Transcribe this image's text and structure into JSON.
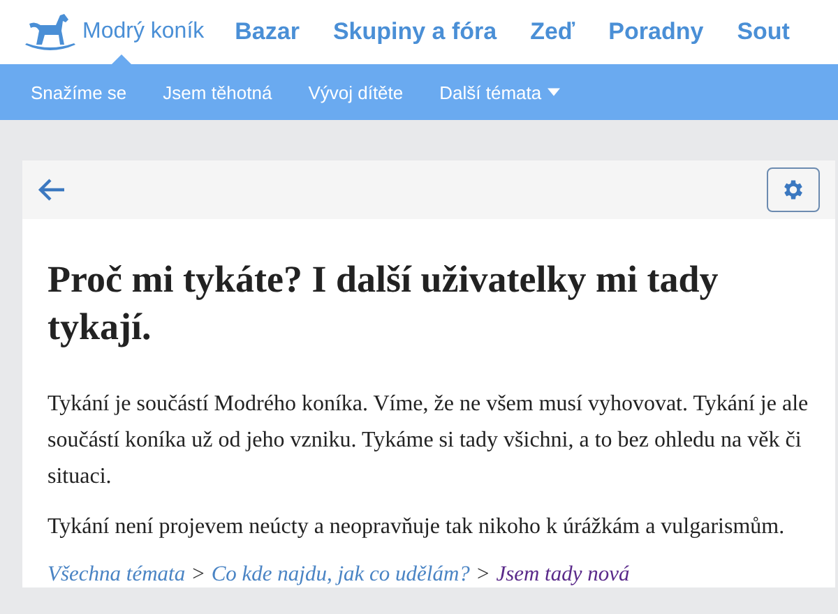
{
  "top_nav": {
    "logo": {
      "text": "Modrý koník",
      "selected": true
    },
    "items": [
      "Bazar",
      "Skupiny a fóra",
      "Zeď",
      "Poradny",
      "Sout"
    ]
  },
  "sub_nav": [
    {
      "label": "Snažíme se",
      "dropdown": false
    },
    {
      "label": "Jsem těhotná",
      "dropdown": false
    },
    {
      "label": "Vývoj dítěte",
      "dropdown": false
    },
    {
      "label": "Další témata",
      "dropdown": true
    }
  ],
  "article": {
    "title": "Proč mi tykáte? I další uživatelky mi tady tykají.",
    "paragraphs": [
      "Tykání je součástí Modrého koníka. Víme, že ne všem musí vyhovovat. Tykání je ale součástí koníka už od jeho vzniku. Tykáme si tady všichni, a to bez ohledu na věk či situaci.",
      "Tykání není projevem neúcty a neopravňuje tak nikoho k úrážkám a vulgarismům."
    ],
    "breadcrumb": {
      "separator": ">",
      "links": [
        {
          "label": "Všechna témata",
          "visited": false
        },
        {
          "label": "Co kde najdu, jak co udělám?",
          "visited": false
        },
        {
          "label": "Jsem tady nová",
          "visited": true
        }
      ]
    }
  }
}
